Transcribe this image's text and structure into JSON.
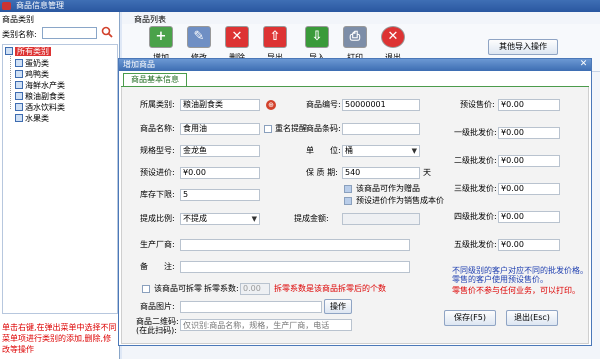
{
  "window": {
    "title": "商品信息管理"
  },
  "left": {
    "title": "商品类别",
    "category_label": "类别名称:",
    "category_value": "",
    "tree": {
      "root": "所有类别",
      "items": [
        "蛋奶类",
        "鸡鸭类",
        "海鲜水产类",
        "粮油副食类",
        "酒水饮料类",
        "水果类"
      ]
    },
    "hint": "单击右键,在弹出菜单中选择不同菜单项进行类别的添加,删除,修改等操作"
  },
  "main": {
    "list_title": "商品列表",
    "toolbar": [
      {
        "label": "增加",
        "icon": "add-icon"
      },
      {
        "label": "修改",
        "icon": "edit-icon"
      },
      {
        "label": "删除",
        "icon": "delete-icon"
      },
      {
        "label": "导出",
        "icon": "export-icon"
      },
      {
        "label": "导入",
        "icon": "import-icon"
      },
      {
        "label": "打印",
        "icon": "print-icon"
      },
      {
        "label": "退出",
        "icon": "exit-icon"
      }
    ],
    "other_import_label": "其他导入操作"
  },
  "dialog": {
    "title": "增加商品",
    "tab": "商品基本信息",
    "fields": {
      "category": {
        "label": "所属类别:",
        "value": "粮油副食类"
      },
      "code": {
        "label": "商品编号:",
        "value": "50000001"
      },
      "name": {
        "label": "商品名称:",
        "value": "食用油"
      },
      "dup_remind": "重名提醒",
      "barcode": {
        "label": "商品条码:",
        "value": ""
      },
      "spec": {
        "label": "规格型号:",
        "value": "金龙鱼"
      },
      "unit": {
        "label": "单　　位:",
        "value": "桶"
      },
      "purchase_price": {
        "label": "预设进价:",
        "value": "¥0.00"
      },
      "shelf_life": {
        "label": "保 质 期:",
        "value": "540",
        "suffix": "天"
      },
      "stock_min": {
        "label": "库存下限:",
        "value": "5"
      },
      "as_gift": "该商品可作为赠品",
      "as_cost": "预设进价作为销售成本价",
      "commission_ratio": {
        "label": "提成比例:",
        "value": "不提成"
      },
      "commission_amount": {
        "label": "提成金额:",
        "value": ""
      },
      "manufacturer": {
        "label": "生产厂商:",
        "value": ""
      },
      "remark": {
        "label": "备　　注:",
        "value": ""
      },
      "splittable": "该商品可拆零",
      "split_factor": {
        "label": "拆零系数:",
        "value": "0.00"
      },
      "split_hint": "拆零系数是该商品拆零后的个数",
      "image": {
        "label": "商品图片:",
        "value": "",
        "button": "操作"
      },
      "qrcode": {
        "label": "商品二维码:",
        "sub_label": "(在此扫码):",
        "placeholder": "仅识别:商品名称，规格，生产厂商，电话"
      }
    },
    "prices": [
      {
        "label": "预设售价:",
        "value": "¥0.00"
      },
      {
        "label": "一级批发价:",
        "value": "¥0.00"
      },
      {
        "label": "二级批发价:",
        "value": "¥0.00"
      },
      {
        "label": "三级批发价:",
        "value": "¥0.00"
      },
      {
        "label": "四级批发价:",
        "value": "¥0.00"
      },
      {
        "label": "五级批发价:",
        "value": "¥0.00"
      }
    ],
    "notes": {
      "line1": "不同级别的客户对应不同的批发价格。",
      "line2": "零售的客户使用预设售价。",
      "line3": "零售价不参与任何业务，可以打印。"
    },
    "save_label": "保存(F5)",
    "exit_label": "退出(Esc)"
  }
}
